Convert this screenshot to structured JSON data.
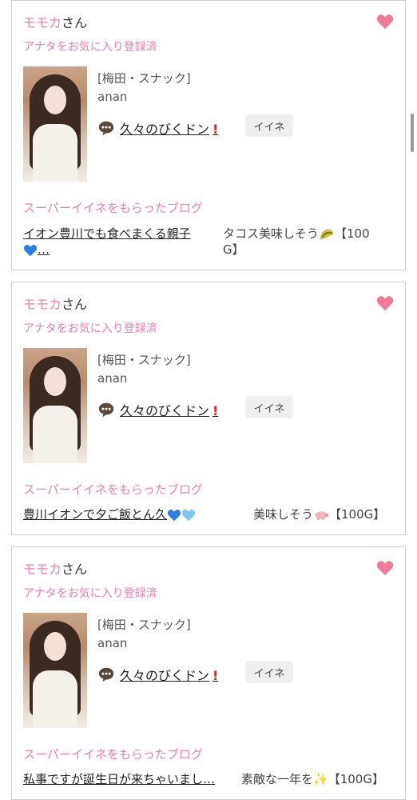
{
  "cards": [
    {
      "user_name": "モモカ",
      "user_suffix": "さん",
      "fav_status": "アナタをお気に入り登録済",
      "shop": "[梅田・スナック]",
      "cast": "anan",
      "message": "久々のびくドン",
      "iine_label": "イイネ",
      "blog_header": "スーパーイイネをもらったブログ",
      "blog_title_line1": "イオン豊川でも食べまくる親子",
      "blog_title_line2": "…",
      "comment_line1": "タコス美味しそう",
      "comment_line2": "G】",
      "comment_points": "【100"
    },
    {
      "user_name": "モモカ",
      "user_suffix": "さん",
      "fav_status": "アナタをお気に入り登録済",
      "shop": "[梅田・スナック]",
      "cast": "anan",
      "message": "久々のびくドン",
      "iine_label": "イイネ",
      "blog_header": "スーパーイイネをもらったブログ",
      "blog_title": "豊川イオンで夕ご飯とん久",
      "comment": "美味しそう",
      "comment_points": "【100G】"
    },
    {
      "user_name": "モモカ",
      "user_suffix": "さん",
      "fav_status": "アナタをお気に入り登録済",
      "shop": "[梅田・スナック]",
      "cast": "anan",
      "message": "久々のびくドン",
      "iine_label": "イイネ",
      "blog_header": "スーパーイイネをもらったブログ",
      "blog_title": "私事ですが誕生日が来ちゃいまし…",
      "comment": "素敵な一年を",
      "comment_points": "【100G】"
    }
  ],
  "colors": {
    "accent_pink": "#ee7fb0",
    "heart": "#f07a98",
    "bang_red": "#d9262e"
  },
  "icons": {
    "favorite": "heart-icon",
    "message": "speech-bubble-icon",
    "alert": "exclamation-icon"
  }
}
